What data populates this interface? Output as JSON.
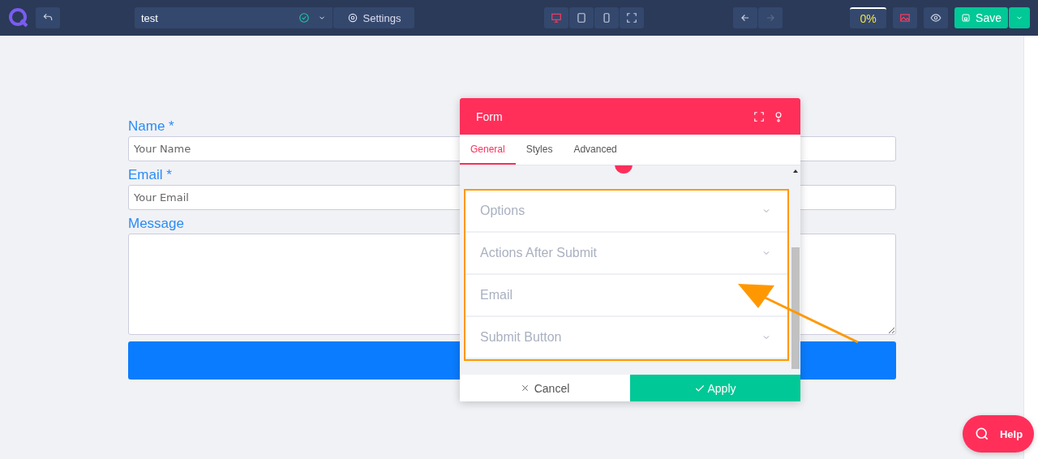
{
  "topbar": {
    "page_name": "test",
    "settings_label": "Settings",
    "devices": [
      {
        "kind": "desktop",
        "selected": true
      },
      {
        "kind": "tablet",
        "selected": false
      },
      {
        "kind": "mobile",
        "selected": false
      },
      {
        "kind": "fullscreen",
        "selected": false
      }
    ],
    "undo_disabled": false,
    "redo_disabled": true,
    "progress": "0%",
    "save_label": "Save"
  },
  "form": {
    "fields": [
      {
        "kind": "input",
        "label": "Name *",
        "placeholder": "Your Name"
      },
      {
        "kind": "input",
        "label": "Email *",
        "placeholder": "Your Email"
      },
      {
        "kind": "textarea",
        "label": "Message"
      }
    ]
  },
  "dialog": {
    "title": "Form",
    "tabs": [
      {
        "label": "General",
        "selected": true
      },
      {
        "label": "Styles",
        "selected": false
      },
      {
        "label": "Advanced",
        "selected": false
      }
    ],
    "sections": [
      {
        "label": "Options",
        "expanded": false
      },
      {
        "label": "Actions After Submit",
        "expanded": false
      },
      {
        "label": "Email",
        "expanded": false
      },
      {
        "label": "Submit Button",
        "expanded": false
      }
    ],
    "cancel_label": "Cancel",
    "apply_label": "Apply"
  },
  "help_label": "Help"
}
